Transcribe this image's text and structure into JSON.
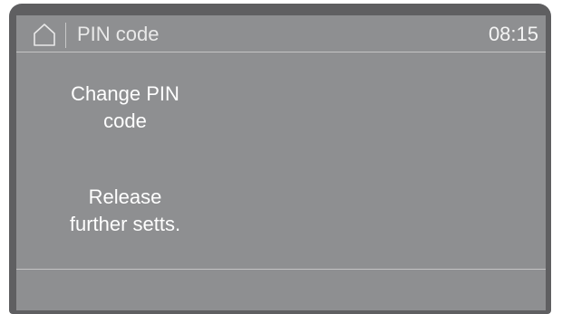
{
  "header": {
    "home_icon": "home-icon",
    "title": "PIN code",
    "time": "08:15"
  },
  "menu": {
    "items": [
      {
        "line1": "Change PIN",
        "line2": "code"
      },
      {
        "line1": "Release",
        "line2": "further setts."
      }
    ]
  },
  "colors": {
    "bezel": "#5f5f61",
    "screen": "#8e8f91",
    "text": "#ffffff",
    "divider": "#c4c4c4"
  }
}
